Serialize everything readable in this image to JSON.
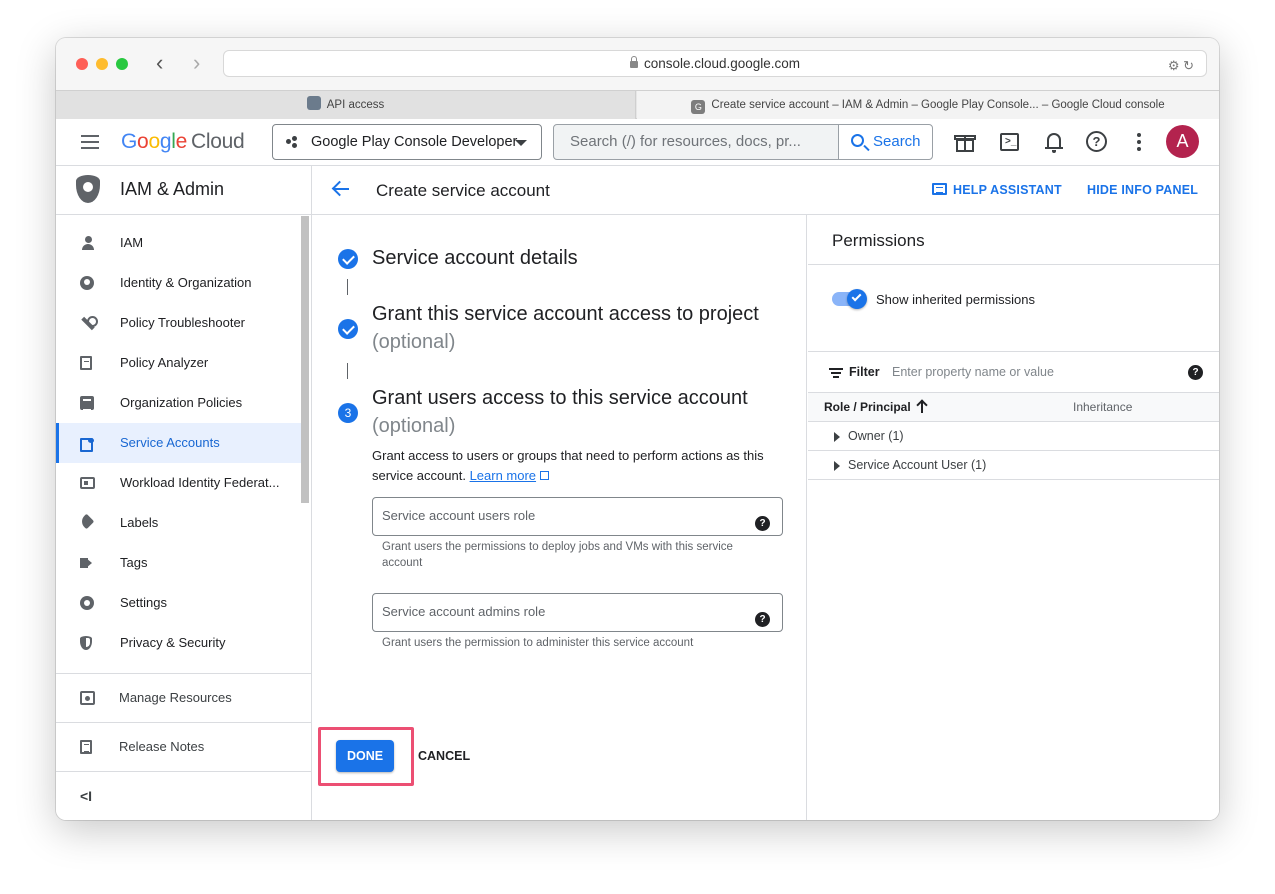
{
  "browser": {
    "url": "console.cloud.google.com",
    "tabs": [
      {
        "label": "API access",
        "active": false
      },
      {
        "label": "Create service account – IAM & Admin – Google Play Console... – Google Cloud console",
        "active": true
      }
    ],
    "tab2_favicon": "G"
  },
  "header": {
    "logo_parts": [
      "G",
      "o",
      "o",
      "g",
      "l",
      "e"
    ],
    "logo_product": "Cloud",
    "project": "Google Play Console Developer",
    "search_placeholder": "Search (/) for resources, docs, pr...",
    "search_button": "Search",
    "avatar_initial": "A",
    "terminal_glyph": ">_",
    "help_glyph": "?",
    "colors": {
      "accent": "#1a73e8",
      "avatar": "#b3234e"
    }
  },
  "sidebar": {
    "title": "IAM & Admin",
    "items": [
      {
        "label": "IAM",
        "icon": "person-add-icon"
      },
      {
        "label": "Identity & Organization",
        "icon": "account-circle-icon"
      },
      {
        "label": "Policy Troubleshooter",
        "icon": "wrench-icon"
      },
      {
        "label": "Policy Analyzer",
        "icon": "document-search-icon"
      },
      {
        "label": "Organization Policies",
        "icon": "list-icon"
      },
      {
        "label": "Service Accounts",
        "icon": "service-account-icon",
        "active": true
      },
      {
        "label": "Workload Identity Federat...",
        "icon": "id-card-icon"
      },
      {
        "label": "Labels",
        "icon": "label-icon"
      },
      {
        "label": "Tags",
        "icon": "tag-icon"
      },
      {
        "label": "Settings",
        "icon": "gear-icon"
      },
      {
        "label": "Privacy & Security",
        "icon": "privacy-shield-icon"
      }
    ],
    "manage_resources": "Manage Resources",
    "release_notes": "Release Notes",
    "collapse": "<I"
  },
  "main": {
    "title": "Create service account",
    "help_assistant": "HELP ASSISTANT",
    "hide_info_panel": "HIDE INFO PANEL",
    "steps": [
      {
        "title": "Service account details",
        "status": "complete"
      },
      {
        "title": "Grant this service account access to project",
        "optional": "(optional)",
        "status": "complete"
      },
      {
        "number": "3",
        "title": "Grant users access to this service account",
        "optional": "(optional)",
        "status": "current"
      }
    ],
    "step3_desc": "Grant access to users or groups that need to perform actions as this service account.",
    "learn_more": "Learn more",
    "users_role_label": "Service account users role",
    "users_role_hint": "Grant users the permissions to deploy jobs and VMs with this service account",
    "admins_role_label": "Service account admins role",
    "admins_role_hint": "Grant users the permission to administer this service account",
    "help_glyph": "?",
    "done": "DONE",
    "cancel": "CANCEL"
  },
  "info_panel": {
    "title": "Permissions",
    "show_inherited": "Show inherited permissions",
    "show_inherited_on": true,
    "filter_label": "Filter",
    "filter_placeholder": "Enter property name or value",
    "col_role": "Role / Principal",
    "col_inheritance": "Inheritance",
    "rows": [
      "Owner (1)",
      "Service Account User (1)"
    ]
  }
}
